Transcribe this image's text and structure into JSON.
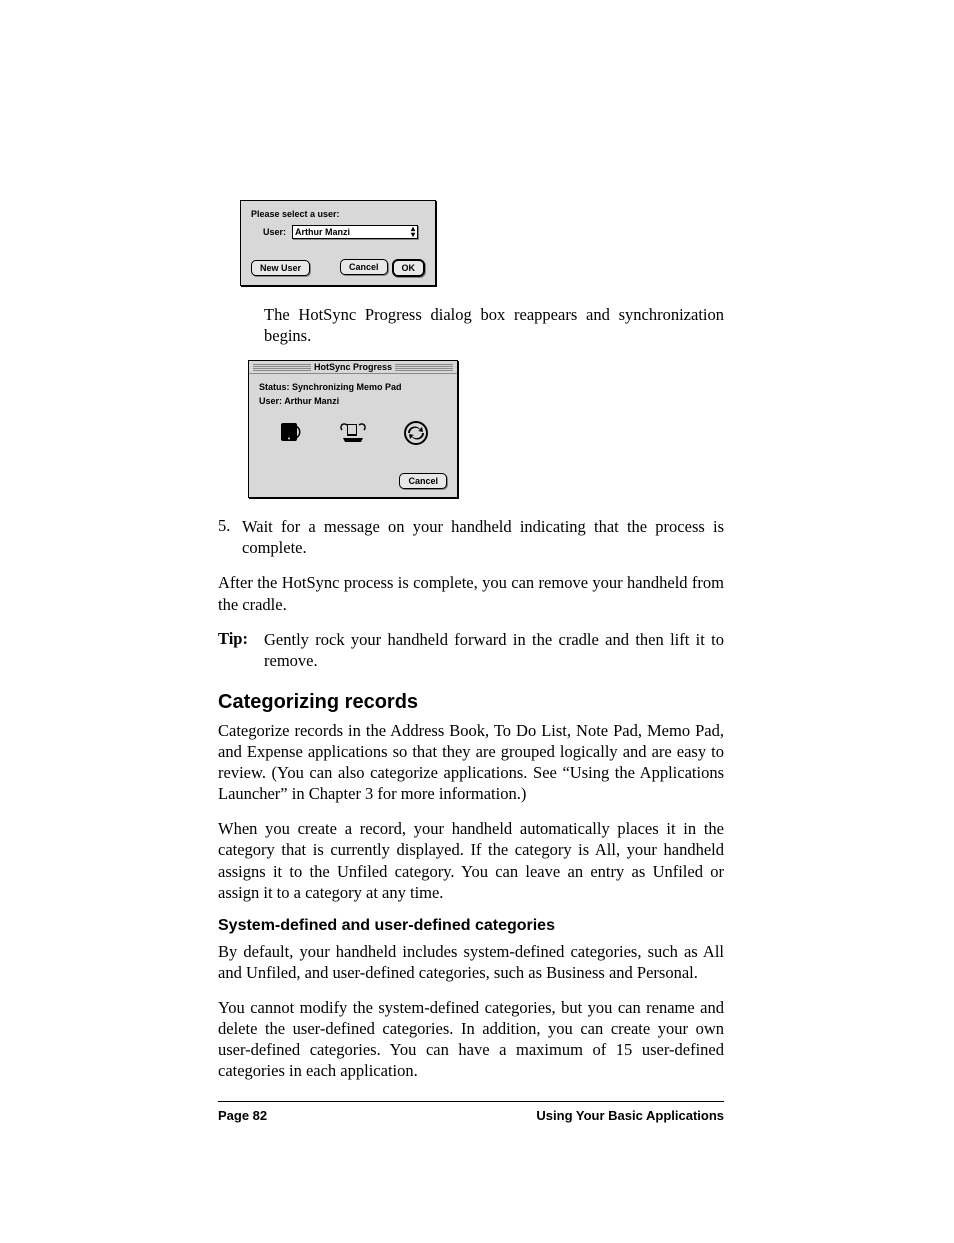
{
  "user_dialog": {
    "prompt": "Please select a user:",
    "user_label": "User:",
    "selected_user": "Arthur Manzi",
    "new_user_btn": "New User",
    "cancel_btn": "Cancel",
    "ok_btn": "OK"
  },
  "paragraph_after_user_dialog": "The HotSync Progress dialog box reappears and synchronization begins.",
  "progress_dialog": {
    "title": "HotSync Progress",
    "status_label": "Status:",
    "status_value": "Synchronizing Memo Pad",
    "user_label": "User:",
    "user_value": "Arthur Manzi",
    "cancel_btn": "Cancel"
  },
  "step5": {
    "number": "5.",
    "text": "Wait for a message on your handheld indicating that the process is complete."
  },
  "after_process": "After the HotSync process is complete, you can remove your handheld from the cradle.",
  "tip": {
    "label": "Tip:",
    "text": "Gently rock your handheld forward in the cradle and then lift it to remove."
  },
  "heading_categorizing": "Categorizing records",
  "categorizing_p1": "Categorize records in the Address Book, To Do List, Note Pad, Memo Pad, and Expense applications so that they are grouped logically and are easy to review. (You can also categorize applications. See “Using the Applications Launcher” in Chapter 3 for more information.)",
  "categorizing_p2": "When you create a record, your handheld automatically places it in the category that is currently displayed. If the category is All, your handheld assigns it to the Unfiled category. You can leave an entry as Unfiled or assign it to a category at any time.",
  "heading_sys_user": "System-defined and user-defined categories",
  "sys_p1": "By default, your handheld includes system-defined categories, such as All and Unfiled, and user-defined categories, such as Business and Personal.",
  "sys_p2": "You cannot modify the system-defined categories, but you can rename and delete the user-defined categories. In addition, you can create your own user-defined categories. You can have a maximum of 15 user-defined categories in each application.",
  "footer": {
    "page": "Page 82",
    "section": "Using Your Basic Applications"
  }
}
